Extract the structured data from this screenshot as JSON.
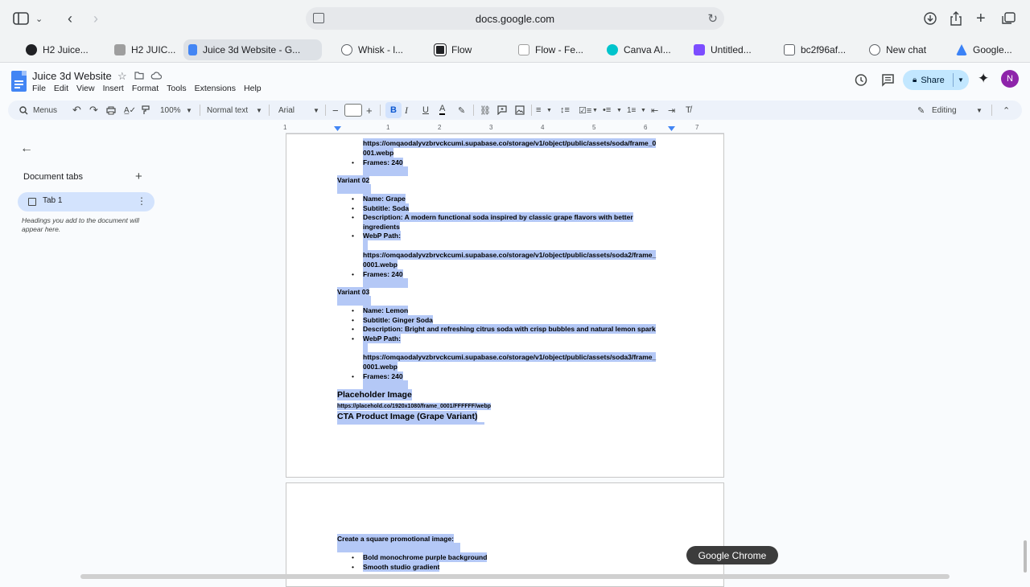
{
  "browser": {
    "url": "docs.google.com",
    "tabs": [
      {
        "label": "H2 Juice...",
        "color": "#202124"
      },
      {
        "label": "H2 JUIC...",
        "color": "#9e9e9e"
      },
      {
        "label": "Juice 3d Website - G...",
        "color": "#4285f4",
        "active": true
      },
      {
        "label": "Whisk - l...",
        "color": "#5f6368"
      },
      {
        "label": "Flow",
        "color": "#202124"
      },
      {
        "label": "Flow - Fe...",
        "color": "#ffffff"
      },
      {
        "label": "Canva AI...",
        "color": "#00c4cc"
      },
      {
        "label": "Untitled...",
        "color": "#7c4dff"
      },
      {
        "label": "bc2f96af...",
        "color": "#5f6368"
      },
      {
        "label": "New chat",
        "color": "#5f6368"
      },
      {
        "label": "Google...",
        "color": "#3b82f6"
      }
    ]
  },
  "doc": {
    "title": "Juice 3d Website",
    "menu": [
      "File",
      "Edit",
      "View",
      "Insert",
      "Format",
      "Tools",
      "Extensions",
      "Help"
    ],
    "share_label": "Share",
    "avatar_initial": "N"
  },
  "toolbar": {
    "search_label": "Menus",
    "zoom": "100%",
    "style": "Normal text",
    "font": "Arial",
    "mode": "Editing"
  },
  "ruler": [
    "1",
    "1",
    "2",
    "3",
    "4",
    "5",
    "6",
    "7"
  ],
  "sidebar": {
    "heading": "Document tabs",
    "tab_label": "Tab 1",
    "hint": "Headings you add to the document will appear here."
  },
  "page1": {
    "lines": [
      "https://omqaodalyvzbrvckcumi.supabase.co/storage/v1/object/public/assets/soda/frame_0",
      "001.webp",
      "Frames: 240",
      "Variant 02",
      "Name: Grape",
      "Subtitle: Soda",
      "Description: A modern functional soda inspired by classic grape flavors with better",
      "ingredients",
      "WebP Path:",
      "https://omqaodalyvzbrvckcumi.supabase.co/storage/v1/object/public/assets/soda2/frame_",
      "0001.webp",
      "Frames: 240",
      "Variant 03",
      "Name: Lemon",
      "Subtitle: Ginger Soda",
      "Description: Bright and refreshing citrus soda with crisp bubbles and natural lemon spark",
      "WebP Path:",
      "https://omqaodalyvzbrvckcumi.supabase.co/storage/v1/object/public/assets/soda3/frame_",
      "0001.webp",
      "Frames: 240",
      "Placeholder Image",
      "https://placehold.co/1920x1080/frame_0001/FFFFFF/webp",
      "CTA Product Image (Grape Variant)"
    ]
  },
  "page2": {
    "lines": [
      "Create a square promotional image:",
      "Bold monochrome purple background",
      "Smooth studio gradient"
    ]
  },
  "tooltip": "Google Chrome"
}
